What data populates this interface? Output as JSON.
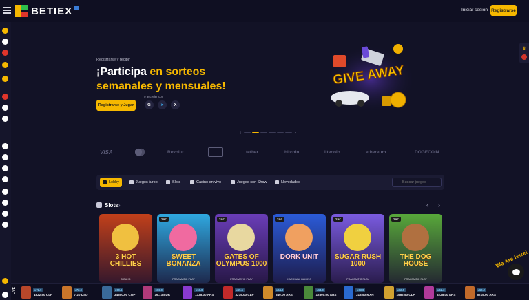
{
  "header": {
    "brand": "BETIEX",
    "login_label": "Iniciar sesión",
    "register_label": "Registrarse"
  },
  "sidebar": {
    "icons": [
      "casino-icon",
      "soccer-icon",
      "fruit-icon",
      "mushroom-icon",
      "chip-icon",
      "calendar-icon",
      "trophy-icon",
      "tennis-icon",
      "basketball-icon",
      "gift-icon",
      "target-icon",
      "star-icon",
      "tv-icon",
      "thumbs-up-icon",
      "gear-icon",
      "spade-icon",
      "flag-icon",
      "headset-icon"
    ]
  },
  "hero": {
    "kicker": "Registrarse y recibir",
    "title_part1": "¡Participa ",
    "title_part2": "en sorteos semanales y mensuales!",
    "cta_label": "Registrarse y Jugar",
    "access_label": "o acceder con",
    "social": [
      {
        "name": "google",
        "glyph": "G",
        "color": "#ffffff"
      },
      {
        "name": "telegram",
        "glyph": "➤",
        "color": "#3aa6e4"
      },
      {
        "name": "x",
        "glyph": "X",
        "color": "#ffffff"
      }
    ],
    "banner_text": "GIVE AWAY"
  },
  "carousel": {
    "slides": 6,
    "active_index": 1
  },
  "payments": [
    "VISA",
    "Revolut",
    "tether",
    "bitcoin",
    "litecoin",
    "ethereum",
    "DOGECOIN"
  ],
  "tabs": [
    {
      "label": "Lobby",
      "active": true
    },
    {
      "label": "Juegos turbo",
      "active": false
    },
    {
      "label": "Slots",
      "active": false
    },
    {
      "label": "Casino en vivo",
      "active": false
    },
    {
      "label": "Juegos con Show",
      "active": false
    },
    {
      "label": "Novedades",
      "active": false
    }
  ],
  "search": {
    "placeholder": "Buscar juegos"
  },
  "slots": {
    "title": "Slots",
    "games": [
      {
        "name": "3 HOT CHILLIES",
        "provider": "3 OAKS",
        "badge": "",
        "bg": "#c2401a"
      },
      {
        "name": "SWEET BONANZA",
        "provider": "PRAGMATIC PLAY",
        "badge": "TOP",
        "bg": "#2fa8e0"
      },
      {
        "name": "GATES OF OLYMPUS 1000",
        "provider": "PRAGMATIC PLAY",
        "badge": "TOP",
        "bg": "#6a3db8"
      },
      {
        "name": "DORK UNIT",
        "provider": "HACKSAW GAMING",
        "badge": "TOP",
        "bg": "#2b5bd8"
      },
      {
        "name": "SUGAR RUSH 1000",
        "provider": "PRAGMATIC PLAY",
        "badge": "TOP",
        "bg": "#7a5be0"
      },
      {
        "name": "THE DOG HOUSE",
        "provider": "PRAGMATIC PLAY",
        "badge": "TOP",
        "bg": "#58a83a"
      }
    ]
  },
  "ticker": {
    "live_label": "LIVE",
    "wins": [
      {
        "mult": "x72.9",
        "amount": "1822.50 CLP",
        "color": "#b8472a"
      },
      {
        "mult": "x72.9",
        "amount": "7.20 USD",
        "color": "#c9752a"
      },
      {
        "mult": "x69.6",
        "amount": "34650.00 COP",
        "color": "#3a6a9a"
      },
      {
        "mult": "x66.9",
        "amount": "16.73 EUR",
        "color": "#b03a7a"
      },
      {
        "mult": "x66.8",
        "amount": "1335.00 ARS",
        "color": "#8a3ad0"
      },
      {
        "mult": "x65.5",
        "amount": "3275.00 CLP",
        "color": "#c22a2a"
      },
      {
        "mult": "x64.0",
        "amount": "640.00 ARS",
        "color": "#d08a2a"
      },
      {
        "mult": "x64.0",
        "amount": "12800.00 ARS",
        "color": "#4a8a3a"
      },
      {
        "mult": "x63.8",
        "amount": "318.50 MXN",
        "color": "#2a6ad0"
      },
      {
        "mult": "x62.5",
        "amount": "1562.50 CLP",
        "color": "#d0a030"
      },
      {
        "mult": "x62.3",
        "amount": "6225.00 ARS",
        "color": "#b03a9a"
      },
      {
        "mult": "x62.2",
        "amount": "6215.00 ARS",
        "color": "#c26a2a"
      }
    ]
  },
  "chat": {
    "label": "We Are Here!"
  }
}
